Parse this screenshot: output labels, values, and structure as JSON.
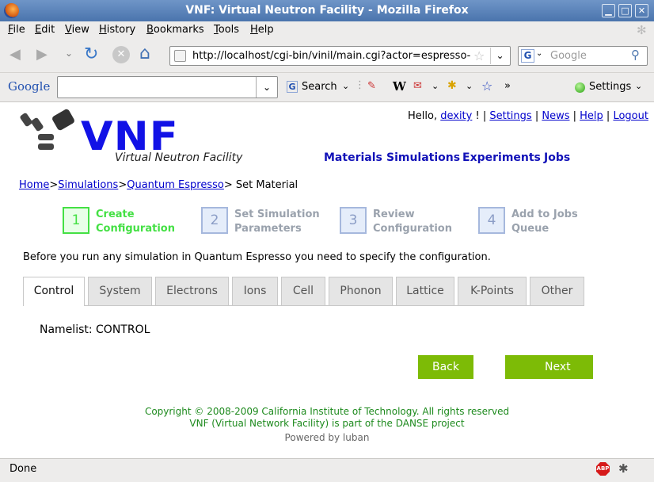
{
  "window": {
    "title": "VNF: Virtual Neutron Facility - Mozilla Firefox"
  },
  "menu": [
    "File",
    "Edit",
    "View",
    "History",
    "Bookmarks",
    "Tools",
    "Help"
  ],
  "address": {
    "url": "http://localhost/cgi-bin/vinil/main.cgi?actor=espresso-n"
  },
  "search": {
    "placeholder": "Google"
  },
  "google_toolbar": {
    "logo": "Google",
    "search_label": "Search",
    "more": "»",
    "settings_label": "Settings"
  },
  "header": {
    "logo_text": "VNF",
    "logo_sub": "Virtual Neutron Facility",
    "hello": "Hello,",
    "user": "dexity",
    "user_links": [
      "Settings",
      "News",
      "Help",
      "Logout"
    ],
    "nav": [
      "Materials",
      "Simulations",
      "Experiments",
      "Jobs"
    ]
  },
  "breadcrumb": {
    "home": "Home",
    "simulations": "Simulations",
    "qe": "Quantum Espresso",
    "current": "Set Material"
  },
  "steps": [
    {
      "num": "1",
      "line1": "Create",
      "line2": "Configuration"
    },
    {
      "num": "2",
      "line1": "Set Simulation",
      "line2": "Parameters"
    },
    {
      "num": "3",
      "line1": "Review",
      "line2": "Configuration"
    },
    {
      "num": "4",
      "line1": "Add to Jobs",
      "line2": "Queue"
    }
  ],
  "colors": {
    "active_step": "#44e044",
    "button": "#7dbb06",
    "footer_green": "#1d8a1d"
  },
  "intro": "Before you run any simulation in Quantum Espresso you need to specify the configuration.",
  "tabs": [
    "Control",
    "System",
    "Electrons",
    "Ions",
    "Cell",
    "Phonon",
    "Lattice",
    "K-Points",
    "Other"
  ],
  "namelist": "Namelist: CONTROL",
  "buttons": {
    "back": "Back",
    "next": "Next"
  },
  "footer": {
    "copyright": "Copyright © 2008-2009 California Institute of Technology. All rights reserved",
    "vnf": "VNF (Virtual Network Facility) is part of the DANSE project",
    "powered": "Powered by luban"
  },
  "status": {
    "text": "Done"
  }
}
